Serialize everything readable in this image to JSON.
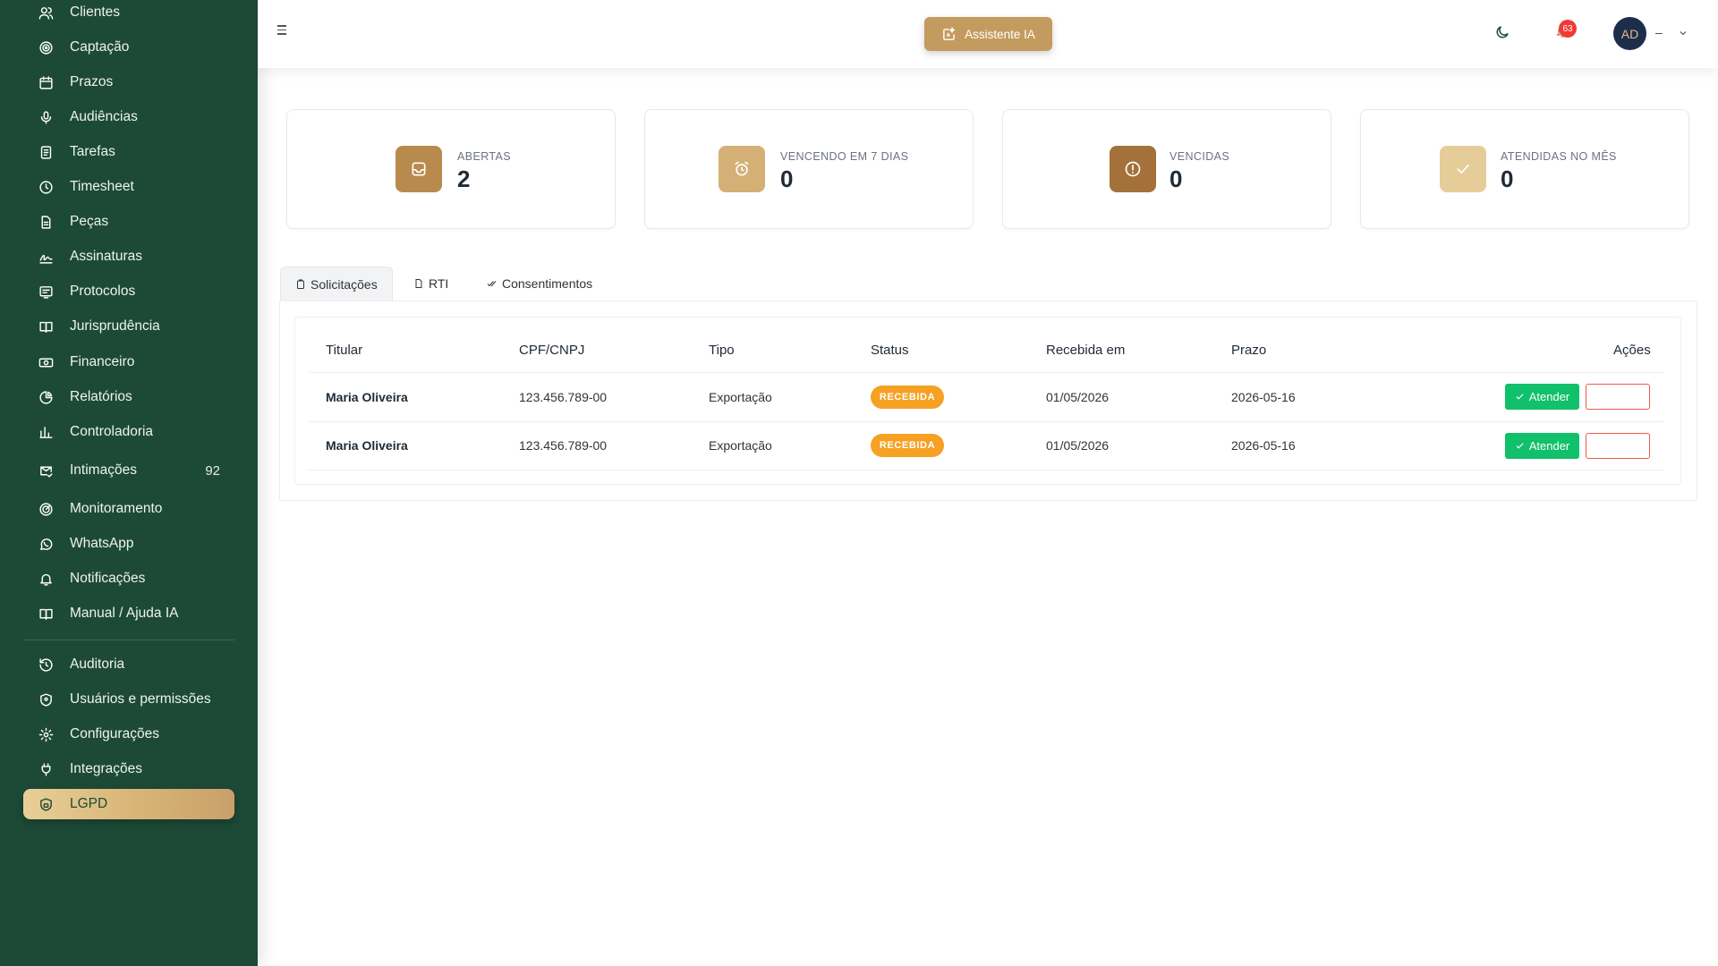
{
  "sidebar": {
    "items": [
      {
        "label": "Clientes",
        "icon": "users-icon"
      },
      {
        "label": "Captação",
        "icon": "target-icon"
      },
      {
        "label": "Prazos",
        "icon": "calendar-icon"
      },
      {
        "label": "Audiências",
        "icon": "microphone-icon"
      },
      {
        "label": "Tarefas",
        "icon": "task-list-icon"
      },
      {
        "label": "Timesheet",
        "icon": "clock-icon"
      },
      {
        "label": "Peças",
        "icon": "document-icon"
      },
      {
        "label": "Assinaturas",
        "icon": "signature-icon"
      },
      {
        "label": "Protocolos",
        "icon": "protocol-icon"
      },
      {
        "label": "Jurisprudência",
        "icon": "book-icon"
      },
      {
        "label": "Financeiro",
        "icon": "money-icon"
      },
      {
        "label": "Relatórios",
        "icon": "pie-chart-icon"
      },
      {
        "label": "Controladoria",
        "icon": "bar-chart-icon"
      },
      {
        "label": "Intimações",
        "icon": "mail-check-icon",
        "count": "92"
      },
      {
        "label": "Monitoramento",
        "icon": "radar-icon"
      },
      {
        "label": "WhatsApp",
        "icon": "whatsapp-icon"
      },
      {
        "label": "Notificações",
        "icon": "bell-icon"
      },
      {
        "label": "Manual / Ajuda IA",
        "icon": "book-open-icon"
      },
      {
        "label": "Auditoria",
        "icon": "history-icon"
      },
      {
        "label": "Usuários e permissões",
        "icon": "shield-icon"
      },
      {
        "label": "Configurações",
        "icon": "gear-icon"
      },
      {
        "label": "Integrações",
        "icon": "plug-icon"
      },
      {
        "label": "LGPD",
        "icon": "shield-lock-icon",
        "active": true
      }
    ]
  },
  "topbar": {
    "assistant_label": "Assistente IA",
    "notifications_count": "63",
    "avatar_initials": "AD",
    "user_name": "–"
  },
  "stats": [
    {
      "label": "ABERTAS",
      "value": "2",
      "color": "#b98a4d",
      "icon": "inbox-icon"
    },
    {
      "label": "VENCENDO EM 7 DIAS",
      "value": "0",
      "color": "#d4b077",
      "icon": "alarm-icon"
    },
    {
      "label": "VENCIDAS",
      "value": "0",
      "color": "#a4713a",
      "icon": "alert-circle-icon"
    },
    {
      "label": "ATENDIDAS NO MÊS",
      "value": "0",
      "color": "#e6cc98",
      "icon": "check-icon"
    }
  ],
  "tabs": [
    {
      "label": "Solicitações",
      "icon": "clipboard-icon",
      "active": true
    },
    {
      "label": "RTI",
      "icon": "file-icon"
    },
    {
      "label": "Consentimentos",
      "icon": "check-all-icon"
    }
  ],
  "table": {
    "headers": [
      "Titular",
      "CPF/CNPJ",
      "Tipo",
      "Status",
      "Recebida em",
      "Prazo",
      "Ações"
    ],
    "rows": [
      {
        "titular": "Maria Oliveira",
        "doc": "123.456.789-00",
        "tipo": "Exportação",
        "status": "RECEBIDA",
        "recebida": "01/05/2026",
        "prazo": "2026-05-16",
        "action": "Atender"
      },
      {
        "titular": "Maria Oliveira",
        "doc": "123.456.789-00",
        "tipo": "Exportação",
        "status": "RECEBIDA",
        "recebida": "01/05/2026",
        "prazo": "2026-05-16",
        "action": "Atender"
      }
    ]
  },
  "colors": {
    "sidebar_bg": "#1d4a37",
    "accent_gold": "#c49b5f",
    "status_orange": "#f6a123",
    "success_green": "#10c06a",
    "danger_red": "#ef5b4b"
  }
}
